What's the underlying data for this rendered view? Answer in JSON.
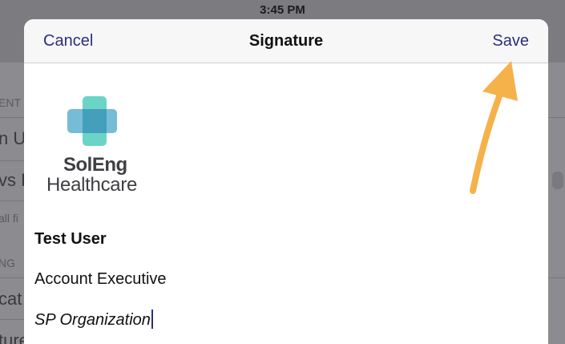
{
  "status_bar": {
    "time": "3:45 PM"
  },
  "background_app": {
    "section_header_1": "ENT",
    "row_1": "n Up",
    "row_2": "vs D",
    "footnote": "all fi",
    "section_header_2": "NG",
    "row_3": "cat",
    "row_4": "ture"
  },
  "nav": {
    "cancel_label": "Cancel",
    "title": "Signature",
    "save_label": "Save"
  },
  "logo": {
    "brand": "SolEng",
    "sub": "Healthcare",
    "colors": {
      "teal": "#5ad0c0",
      "blue": "#3b8fb3"
    }
  },
  "signature": {
    "name": "Test User",
    "title": "Account Executive",
    "organization": "SP Organization"
  },
  "annotation": {
    "color": "#f5b24b",
    "icon": "arrow-pointing-to-save"
  }
}
